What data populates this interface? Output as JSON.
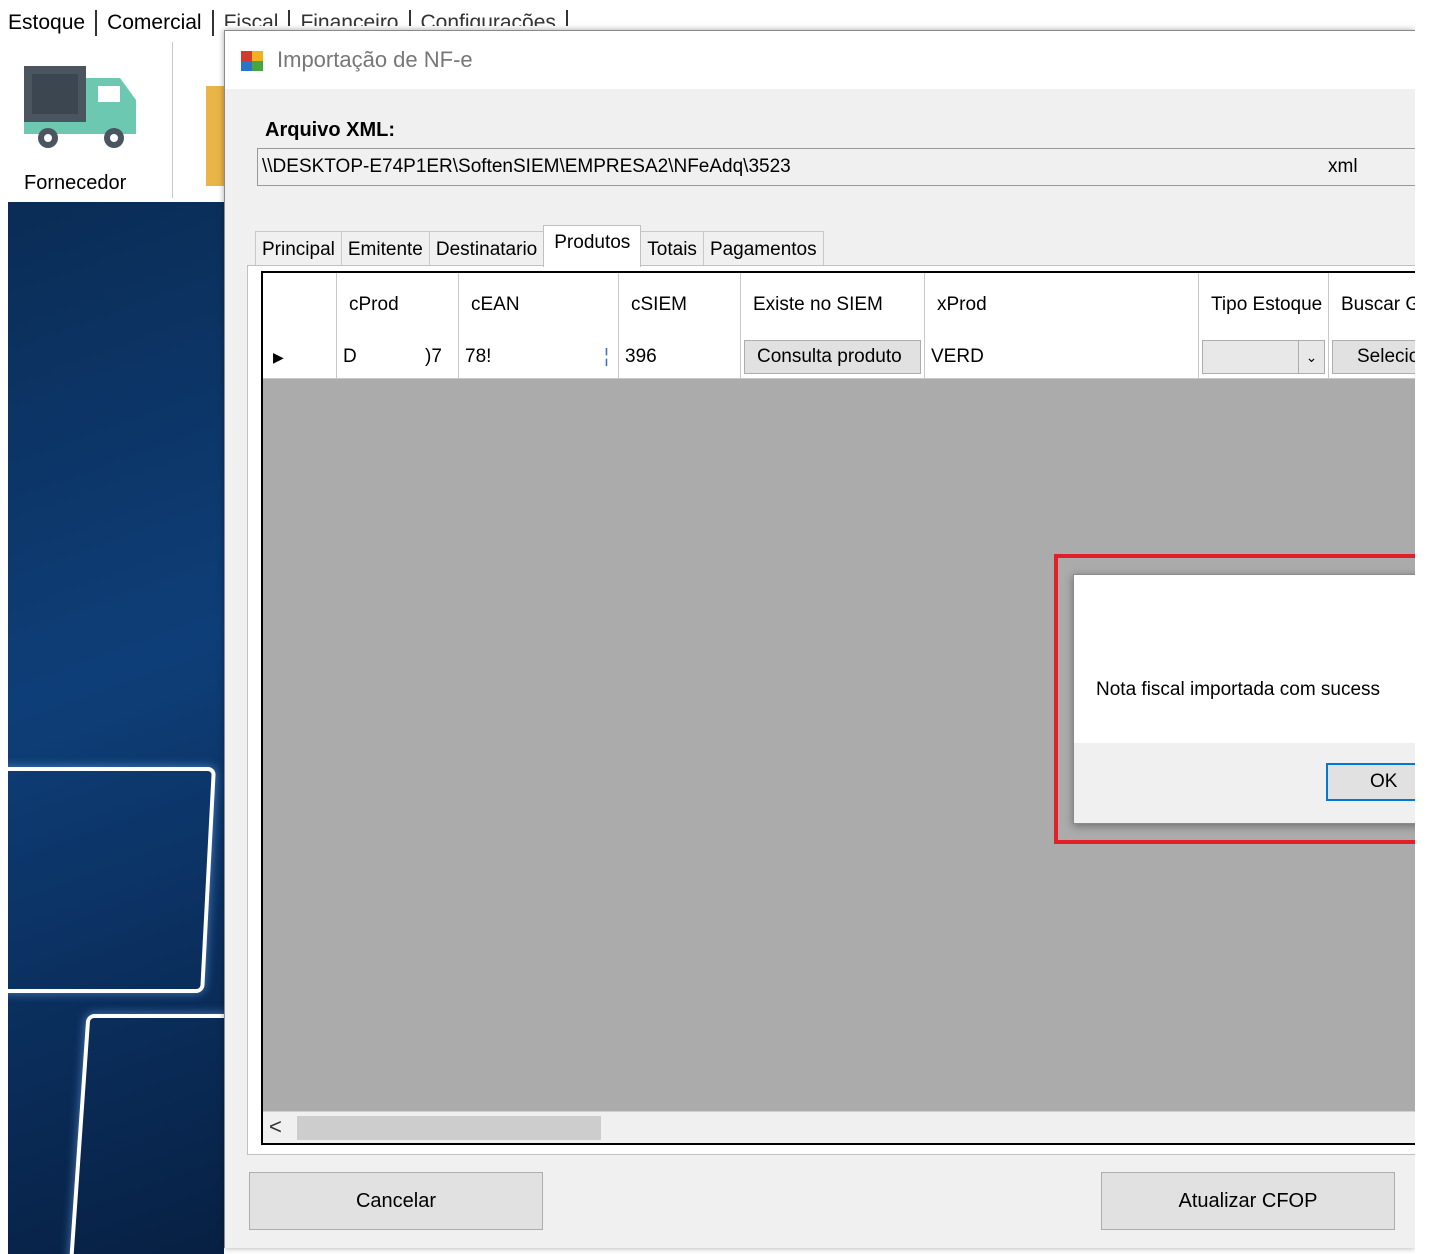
{
  "menubar": {
    "tabs": [
      "Estoque",
      "Comercial",
      "Fiscal",
      "Financeiro",
      "Configurações"
    ]
  },
  "ribbon": {
    "fornecedor_label": "Fornecedor",
    "fornecedor_icon": "truck-icon"
  },
  "dialog": {
    "title": "Importação de NF-e",
    "xml_label": "Arquivo XML:",
    "xml_path": "\\\\DESKTOP-E74P1ER\\SoftenSIEM\\EMPRESA2\\NFeAdq\\3523",
    "xml_ext": "xml",
    "tabs": [
      {
        "label": "Principal"
      },
      {
        "label": "Emitente"
      },
      {
        "label": "Destinatario"
      },
      {
        "label": "Produtos",
        "active": true
      },
      {
        "label": "Totais"
      },
      {
        "label": "Pagamentos"
      }
    ],
    "grid": {
      "headers": [
        "cProd",
        "cEAN",
        "cSIEM",
        "Existe no SIEM",
        "xProd",
        "Tipo Estoque",
        "Buscar G"
      ],
      "row": {
        "indicator": "▶",
        "cProd": "D",
        "cProd_tail": ")7",
        "cEAN": "78!",
        "cEAN_tail": "¦",
        "cSIEM": "396",
        "existe_button": "Consulta produto",
        "xProd": "VERD",
        "buscar_button": "Selecio"
      }
    },
    "buttons": {
      "cancel": "Cancelar",
      "cfop": "Atualizar CFOP"
    }
  },
  "messagebox": {
    "text": "Nota fiscal importada com sucess",
    "ok": "OK"
  },
  "colors": {
    "highlight": "#e3202a",
    "grid_background": "#ababab",
    "desktop_blue": "#0e3e78"
  }
}
